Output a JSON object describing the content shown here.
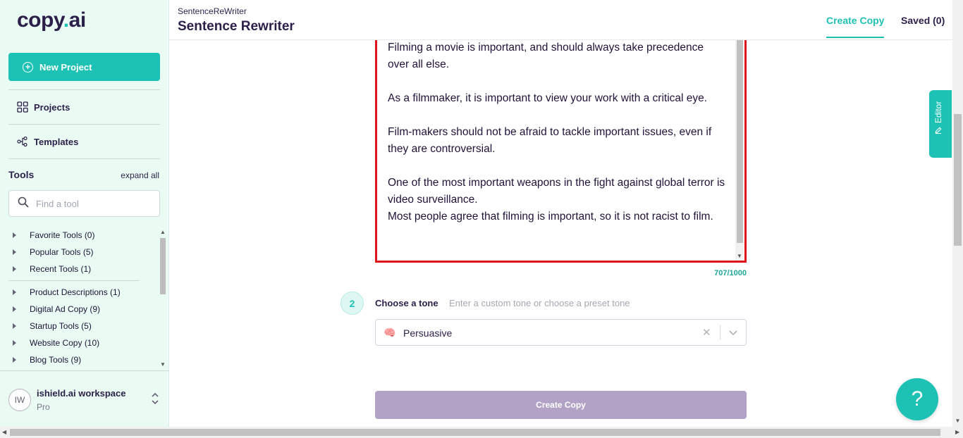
{
  "sidebar": {
    "logo": {
      "part1": "copy",
      "dot": ".",
      "part2": "ai"
    },
    "new_project": "New Project",
    "nav": {
      "projects": "Projects",
      "templates": "Templates"
    },
    "tools_label": "Tools",
    "expand_all": "expand all",
    "search_placeholder": "Find a tool",
    "tools": [
      "Favorite Tools (0)",
      "Popular Tools (5)",
      "Recent Tools (1)",
      "Product Descriptions (1)",
      "Digital Ad Copy (9)",
      "Startup Tools (5)",
      "Website Copy (10)",
      "Blog Tools (9)"
    ],
    "workspace": {
      "initials": "IW",
      "name": "ishield.ai workspace",
      "plan": "Pro"
    }
  },
  "header": {
    "breadcrumb": "SentenceReWriter",
    "title": "Sentence Rewriter",
    "tabs": {
      "create": "Create Copy",
      "saved": "Saved (0)"
    }
  },
  "main": {
    "textarea_value": "Filming a movie is important, and should always take precedence over all else.\n\nAs a filmmaker, it is important to view your work with a critical eye.\n\nFilm-makers should not be afraid to tackle important issues, even if they are controversial.\n\nOne of the most important weapons in the fight against global terror is video surveillance.\nMost people agree that filming is important, so it is not racist to film.",
    "char_count": "707/1000",
    "step_number": "2",
    "tone_label": "Choose a tone",
    "tone_hint": "Enter a custom tone or choose a preset tone",
    "tone_emoji": "🧠",
    "tone_value": "Persuasive",
    "clear_glyph": "✕",
    "create_button": "Create Copy",
    "editor_tab": "Editor",
    "help_glyph": "?"
  },
  "colors": {
    "accent": "#1ec2b4",
    "error_border": "#e0121c",
    "sidebar_bg": "#e9fbf3",
    "disabled_button": "#b1a2c6",
    "brand_text": "#2c1f4a"
  }
}
